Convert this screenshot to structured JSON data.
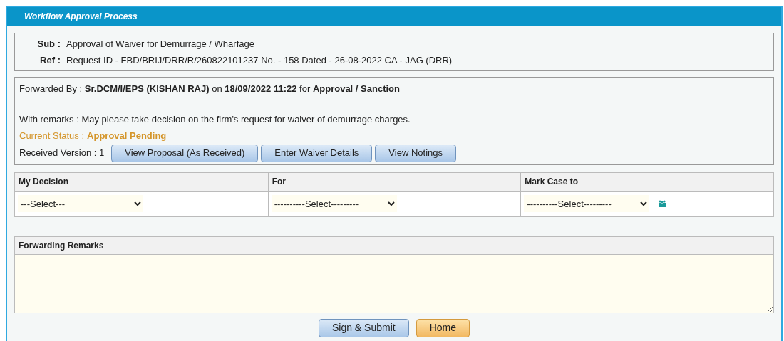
{
  "panel": {
    "title": "Workflow Approval Process"
  },
  "reference": [
    {
      "label": "Sub :",
      "value": "Approval of Waiver for Demurrage / Wharfage"
    },
    {
      "label": "Ref :",
      "value": "Request ID - FBD/BRIJ/DRR/R/260822101237 No. - 158 Dated - 26-08-2022 CA - JAG (DRR)"
    }
  ],
  "forwarded": "Forwarded By : **Sr.DCM/I/EPS (KISHAN RAJ)** on **18/09/2022 11:22** for **Approval / Sanction**",
  "remarks": "With remarks : May please take decision on the firm's request for waiver of demurrage charges.",
  "status": {
    "label": "Current Status :",
    "value": "Approval Pending"
  },
  "version": "Received Version : 1",
  "actions": [
    "View Proposal (As Received)",
    "Enter Waiver Details",
    "View Notings"
  ],
  "decision_table": {
    "columns": [
      {
        "header": "My Decision",
        "value": "---Select---",
        "people_icon": false
      },
      {
        "header": "For",
        "value": "----------Select---------",
        "people_icon": false
      },
      {
        "header": "Mark Case to",
        "value": "----------Select---------",
        "people_icon": true
      }
    ]
  },
  "forwarding_remarks": {
    "label": "Forwarding Remarks"
  },
  "buttons": [
    {
      "label": "Sign & Submit",
      "kind": "primary"
    },
    {
      "label": "Home",
      "kind": "home"
    }
  ]
}
